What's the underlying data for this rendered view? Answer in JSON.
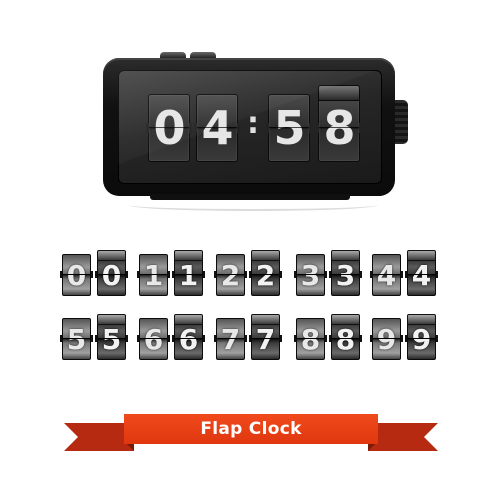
{
  "clock": {
    "hour_tens": "0",
    "hour_ones": "4",
    "separator": ":",
    "minute_tens": "5",
    "minute_ones": "8"
  },
  "digit_samples": [
    {
      "back": "0",
      "front": "0"
    },
    {
      "back": "1",
      "front": "1"
    },
    {
      "back": "2",
      "front": "2"
    },
    {
      "back": "3",
      "front": "3"
    },
    {
      "back": "4",
      "front": "4"
    },
    {
      "back": "5",
      "front": "5"
    },
    {
      "back": "6",
      "front": "6"
    },
    {
      "back": "7",
      "front": "7"
    },
    {
      "back": "8",
      "front": "8"
    },
    {
      "back": "9",
      "front": "9"
    }
  ],
  "banner": {
    "title": "Flap Clock",
    "color": "#e8401a"
  }
}
